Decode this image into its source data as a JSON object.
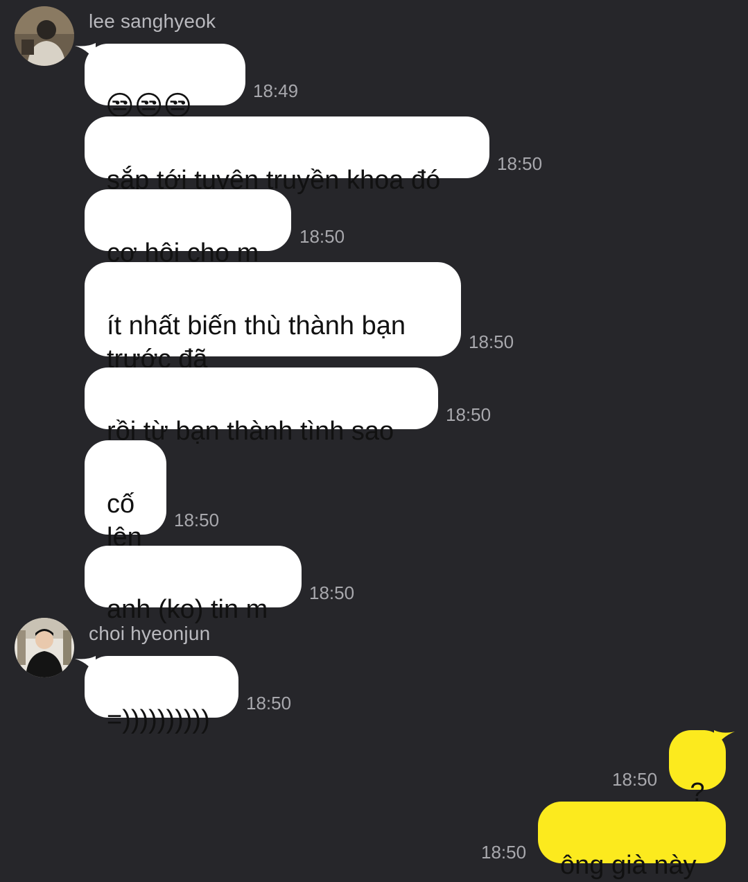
{
  "messages": {
    "sender1": {
      "name": "lee sanghyeok",
      "items": [
        {
          "text": "😒😒😒",
          "time": "18:49"
        },
        {
          "text": "sắp tới tuyên truyền khoa đó",
          "time": "18:50"
        },
        {
          "text": "cơ hội cho m",
          "time": "18:50"
        },
        {
          "text": "ít nhất biến thù thành bạn\ntrước đã",
          "time": "18:50"
        },
        {
          "text": "rồi từ bạn thành tình sao",
          "time": "18:50"
        },
        {
          "text": "cố\nlên",
          "time": "18:50"
        },
        {
          "text": "anh (ko) tin m",
          "time": "18:50"
        }
      ]
    },
    "sender2": {
      "name": "choi hyeonjun",
      "items": [
        {
          "text": "=))))))))))",
          "time": "18:50"
        }
      ]
    },
    "mine": {
      "items": [
        {
          "text": "?",
          "time": "18:50"
        },
        {
          "text": "ông già này",
          "time": "18:50"
        }
      ]
    }
  },
  "colors": {
    "background": "#26262a",
    "incoming_bubble": "#ffffff",
    "outgoing_bubble": "#fcea1e",
    "meta_text": "#a8a8ad"
  }
}
